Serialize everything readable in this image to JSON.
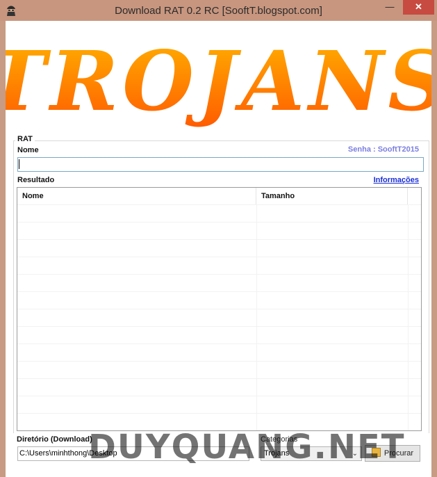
{
  "window": {
    "title": "Download RAT 0.2 RC [SooftT.blogspot.com]",
    "controls": {
      "minimize": "—",
      "maximize": "☐",
      "close": "✕"
    }
  },
  "banner": {
    "text": "TROJANS",
    "gradient_top": "#ffb300",
    "gradient_bottom": "#ff5a00"
  },
  "group": {
    "label": "RAT",
    "nome_label": "Nome",
    "senha": "Senha : SooftT2015",
    "name_value": "",
    "resultado_label": "Resultado",
    "informacoes_link": "Informações"
  },
  "table": {
    "columns": [
      "Nome",
      "Tamanho"
    ],
    "rows": []
  },
  "footer": {
    "diretorio_label": "Diretório (Download)",
    "diretorio_value": "C:\\Users\\minhthong\\Desktop",
    "categorias_label": "Categorias",
    "categoria_value": "Trojans",
    "procurar_label": "Procurar"
  },
  "watermark": "DUYQUANG.NET",
  "colors": {
    "titlebar": "#c8967f",
    "close_button": "#c74b41",
    "senha": "#7b7fe0",
    "link": "#1b2fd6"
  }
}
